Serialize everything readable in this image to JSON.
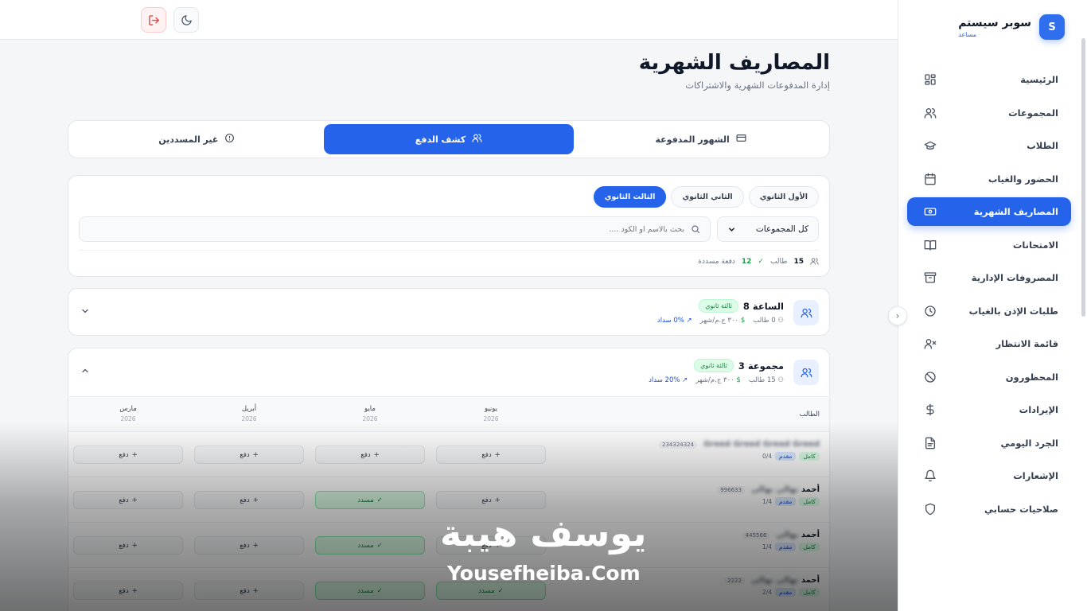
{
  "brand": {
    "logo_letter": "S",
    "name": "سوبر سيستم",
    "role": "مساعد"
  },
  "sidebar": {
    "items": [
      {
        "label": "الرئيسية",
        "icon": "dashboard-icon"
      },
      {
        "label": "المجموعات",
        "icon": "users-icon"
      },
      {
        "label": "الطلاب",
        "icon": "graduation-cap-icon"
      },
      {
        "label": "الحضور والغياب",
        "icon": "calendar-icon"
      },
      {
        "label": "المصاريف الشهرية",
        "icon": "banknote-icon",
        "active": true
      },
      {
        "label": "الامتحانات",
        "icon": "book-icon"
      },
      {
        "label": "المصروفات الإدارية",
        "icon": "archive-icon"
      },
      {
        "label": "طلبات الإذن بالغياب",
        "icon": "clock-icon"
      },
      {
        "label": "قائمة الانتظار",
        "icon": "user-x-icon"
      },
      {
        "label": "المحظورون",
        "icon": "ban-icon"
      },
      {
        "label": "الإيرادات",
        "icon": "dollar-icon"
      },
      {
        "label": "الجرد اليومي",
        "icon": "file-icon"
      },
      {
        "label": "الإشعارات",
        "icon": "bell-icon"
      },
      {
        "label": "صلاحيات حسابي",
        "icon": "shield-icon"
      }
    ]
  },
  "header": {
    "title": "المصاريف الشهرية",
    "subtitle": "إدارة المدفوعات الشهرية والاشتراكات"
  },
  "tabs": [
    {
      "label": "الشهور المدفوعة",
      "icon": "credit-card-icon"
    },
    {
      "label": "كشف الدفع",
      "icon": "users-icon",
      "active": true
    },
    {
      "label": "غير المسددين",
      "icon": "alert-circle-icon"
    }
  ],
  "filters": {
    "grades": [
      {
        "label": "الأول الثانوي"
      },
      {
        "label": "الثاني الثانوي"
      },
      {
        "label": "الثالث الثانوي",
        "active": true
      }
    ],
    "group_select": "كل المجموعات",
    "search_placeholder": "بحث بالاسم او الكود ....",
    "stats": {
      "students_count": "15",
      "students_label": "طالب",
      "paid_count": "12",
      "paid_label": "دفعة مسددة"
    }
  },
  "groups": [
    {
      "name": "الساعة 8",
      "badge": "ثالثة ثانوي",
      "students": "0 طالب",
      "price": "٣٠٠ ج.م/شهر",
      "payment_rate": "0% سداد",
      "expanded": false
    },
    {
      "name": "مجموعة 3",
      "badge": "ثالثة ثانوي",
      "students": "15 طالب",
      "price": "٣٠٠ ج.م/شهر",
      "payment_rate": "20% سداد",
      "expanded": true
    }
  ],
  "table": {
    "student_header": "الطالب",
    "months": [
      {
        "name": "يونيو",
        "year": "2026"
      },
      {
        "name": "مايو",
        "year": "2026"
      },
      {
        "name": "أبريل",
        "year": "2026"
      },
      {
        "name": "مارس",
        "year": "2026"
      }
    ],
    "pay_label": "دفع",
    "paid_label": "مسدد",
    "rows": [
      {
        "name": "",
        "name_blur": "Greed Greed Greed Greed",
        "code": "234324324",
        "tag_full": "كامل",
        "tag_adv": "مقدم",
        "count": "0/4",
        "status": [
          "pay",
          "pay",
          "pay",
          "pay"
        ]
      },
      {
        "name": "أحمد",
        "name_blur": "نهالي نهالي",
        "code": "996633",
        "tag_full": "كامل",
        "tag_adv": "مقدم",
        "count": "1/4",
        "status": [
          "pay",
          "paid",
          "pay",
          "pay"
        ]
      },
      {
        "name": "أحمد",
        "name_blur": "نهالي",
        "code": "445566",
        "tag_full": "كامل",
        "tag_adv": "مقدم",
        "count": "1/4",
        "status": [
          "pay",
          "paid",
          "pay",
          "pay"
        ]
      },
      {
        "name": "أحمد",
        "name_blur": "نهالي نهالي",
        "code": "2222",
        "tag_full": "كامل",
        "tag_adv": "مقدم",
        "count": "2/4",
        "status": [
          "paid",
          "paid",
          "pay",
          "pay"
        ]
      }
    ]
  },
  "watermark": {
    "arabic": "يوسف هيبة",
    "english": "Yousefheiba.Com"
  },
  "colors": {
    "primary": "#2563eb",
    "success": "#16a34a",
    "danger": "#ef4444"
  }
}
